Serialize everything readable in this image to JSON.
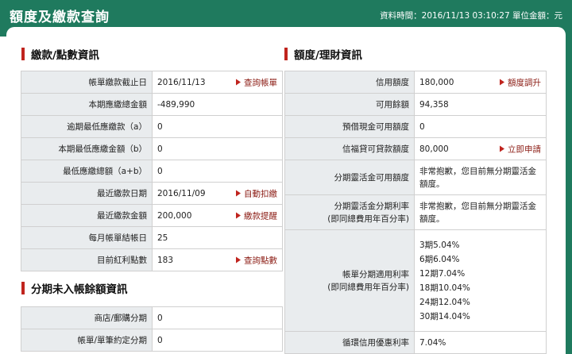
{
  "header": {
    "title": "額度及繳款查詢",
    "meta": "資料時間：2016/11/13 03:10:27 單位金額：元"
  },
  "payment": {
    "title": "繳款/點數資訊",
    "rows": [
      {
        "label": "帳單繳款截止日",
        "value": "2016/11/13",
        "link": "查詢帳單"
      },
      {
        "label": "本期應繳總金額",
        "value": "-489,990",
        "link": ""
      },
      {
        "label": "逾期最低應繳款（a）",
        "value": "0",
        "link": ""
      },
      {
        "label": "本期最低應繳金額（b）",
        "value": "0",
        "link": ""
      },
      {
        "label": "最低應繳總額（a+b）",
        "value": "0",
        "link": ""
      },
      {
        "label": "最近繳款日期",
        "value": "2016/11/09",
        "link": "自動扣繳"
      },
      {
        "label": "最近繳款金額",
        "value": "200,000",
        "link": "繳款提醒"
      },
      {
        "label": "每月帳單結帳日",
        "value": "25",
        "link": ""
      },
      {
        "label": "目前紅利點數",
        "value": "183",
        "link": "查詢點數"
      }
    ]
  },
  "installment": {
    "title": "分期未入帳餘額資訊",
    "rows": [
      {
        "label": "商店/郵購分期",
        "value": "0"
      },
      {
        "label": "帳單/單筆約定分期",
        "value": "0"
      }
    ]
  },
  "credit": {
    "title": "額度/理財資訊",
    "rows": [
      {
        "label": "信用額度",
        "value": "180,000",
        "link": "額度調升"
      },
      {
        "label": "可用餘額",
        "value": "94,358",
        "link": ""
      },
      {
        "label": "預借現金可用額度",
        "value": "0",
        "link": ""
      },
      {
        "label": "信福貸可貸款額度",
        "value": "80,000",
        "link": "立即申請"
      }
    ],
    "quick_label": "分期靈活金可用額度",
    "quick_value": "非常抱歉，您目前無分期靈活金額度。",
    "quick_rate_label_1": "分期靈活金分期利率",
    "quick_rate_label_2": "(即同總費用年百分率)",
    "quick_rate_value": "非常抱歉，您目前無分期靈活金額度。",
    "bill_rate_label_1": "帳單分期適用利率",
    "bill_rate_label_2": "(即同總費用年百分率)",
    "bill_rates": [
      "3期5.04%",
      "6期6.04%",
      "12期7.04%",
      "18期10.04%",
      "24期12.04%",
      "30期14.04%"
    ],
    "revolving_label": "循環信用優惠利率",
    "revolving_value": "7.04%"
  },
  "colors": {
    "header": "#1f7a5e",
    "accent": "#c0241e",
    "link": "#8b1b13",
    "label_bg": "#e9ecee"
  }
}
